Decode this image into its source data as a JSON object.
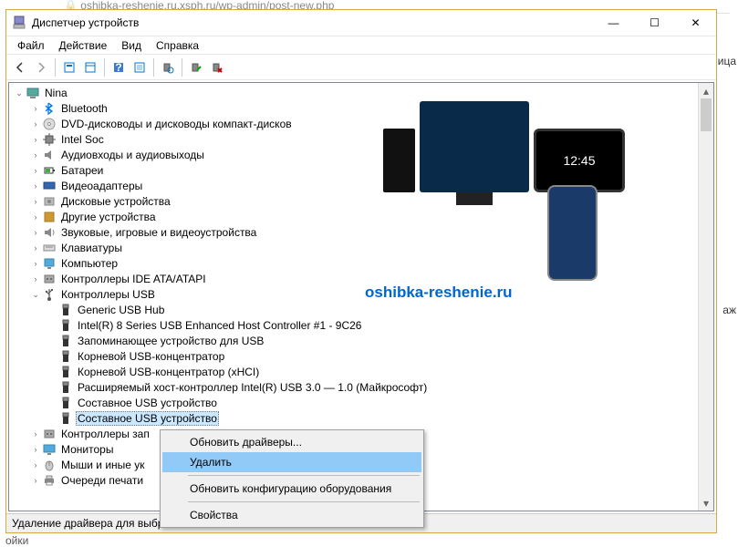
{
  "window": {
    "title": "Диспетчер устройств"
  },
  "win_controls": {
    "min": "—",
    "max": "☐",
    "close": "✕"
  },
  "menu": [
    "Файл",
    "Действие",
    "Вид",
    "Справка"
  ],
  "toolbar_icons": [
    "back",
    "forward",
    "|",
    "show-hidden",
    "properties",
    "|",
    "help",
    "refresh",
    "|",
    "scan-hardware",
    "|",
    "enable",
    "disable"
  ],
  "watermark": "oshibka-reshenie.ru",
  "root_node": "Nina",
  "categories": [
    {
      "icon": "bluetooth",
      "label": "Bluetooth",
      "expander": ">"
    },
    {
      "icon": "dvd",
      "label": "DVD-дисководы и дисководы компакт-дисков",
      "expander": ">"
    },
    {
      "icon": "cpu",
      "label": "Intel Soc",
      "expander": ">"
    },
    {
      "icon": "audio",
      "label": "Аудиовходы и аудиовыходы",
      "expander": ">"
    },
    {
      "icon": "battery",
      "label": "Батареи",
      "expander": ">"
    },
    {
      "icon": "video",
      "label": "Видеоадаптеры",
      "expander": ">"
    },
    {
      "icon": "disk",
      "label": "Дисковые устройства",
      "expander": ">"
    },
    {
      "icon": "other",
      "label": "Другие устройства",
      "expander": ">"
    },
    {
      "icon": "sound",
      "label": "Звуковые, игровые и видеоустройства",
      "expander": ">"
    },
    {
      "icon": "keyboard",
      "label": "Клавиатуры",
      "expander": ">"
    },
    {
      "icon": "computer",
      "label": "Компьютер",
      "expander": ">"
    },
    {
      "icon": "ide",
      "label": "Контроллеры IDE ATA/ATAPI",
      "expander": ">"
    }
  ],
  "usb_controller": {
    "label": "Контроллеры USB",
    "expander": "v",
    "children": [
      "Generic USB Hub",
      "Intel(R) 8 Series USB Enhanced Host Controller #1 - 9C26",
      "Запоминающее устройство для USB",
      "Корневой USB-концентратор",
      "Корневой USB-концентратор (xHCI)",
      "Расширяемый хост-контроллер Intel(R) USB 3.0 — 1.0 (Майкрософт)",
      "Составное USB устройство",
      "Составное USB устройство"
    ],
    "selected_index": 7
  },
  "after_usb": [
    {
      "icon": "ide",
      "label": "Контроллеры зап",
      "expander": ">"
    },
    {
      "icon": "monitor",
      "label": "Мониторы",
      "expander": ">"
    },
    {
      "icon": "mouse",
      "label": "Мыши и иные ук",
      "expander": ">"
    },
    {
      "icon": "printer",
      "label": "Очереди печати",
      "expander": ">"
    }
  ],
  "context_menu": {
    "items": [
      {
        "label": "Обновить драйверы...",
        "type": "item"
      },
      {
        "label": "Удалить",
        "type": "item",
        "highlighted": true
      },
      {
        "type": "sep"
      },
      {
        "label": "Обновить конфигурацию оборудования",
        "type": "item"
      },
      {
        "type": "sep"
      },
      {
        "label": "Свойства",
        "type": "item"
      }
    ]
  },
  "statusbar": "Удаление драйвера для выбр",
  "partial_bg": {
    "right1": "ница",
    "right2": "аж"
  },
  "address_fragment": "oshibka-reshenie.ru.xsph.ru/wp-admin/post-new.php",
  "tab_fragment": "ойки"
}
